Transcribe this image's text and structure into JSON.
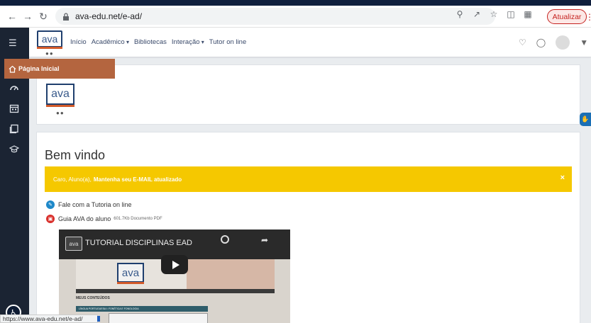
{
  "browser": {
    "url": "ava-edu.net/e-ad/",
    "update_label": "Atualizar",
    "status_url": "https://www.ava-edu.net/e-ad/"
  },
  "site": {
    "logo_text": "ava",
    "menu": [
      {
        "label": "Início",
        "dropdown": false
      },
      {
        "label": "Acadêmico",
        "dropdown": true
      },
      {
        "label": "Bibliotecas",
        "dropdown": false
      },
      {
        "label": "Interação",
        "dropdown": true
      },
      {
        "label": "Tutor on line",
        "dropdown": false
      }
    ]
  },
  "sidebar": {
    "home_label": "Página Inicial"
  },
  "content": {
    "welcome_title": "Bem vindo",
    "alert": {
      "prefix": "Caro, Aluno(a),",
      "strong": "Mantenha seu E-MAIL atualizado",
      "close": "×"
    },
    "links": [
      {
        "label": "Fale com a Tutoria on line",
        "meta": ""
      },
      {
        "label": "Guia AVA do aluno",
        "meta": "601.7Kb Documento PDF"
      }
    ],
    "video": {
      "title": "TUTORIAL DISCIPLINAS EAD",
      "inner_heading": "MEUS CONTEÚDOS",
      "inner_strip": "LÍNGUA PORTUGUESA I: FONÉTICA E FONOLOGIA"
    }
  },
  "colors": {
    "accent": "#b4653f",
    "alert": "#f5c800",
    "sidebar": "#1b2433"
  }
}
